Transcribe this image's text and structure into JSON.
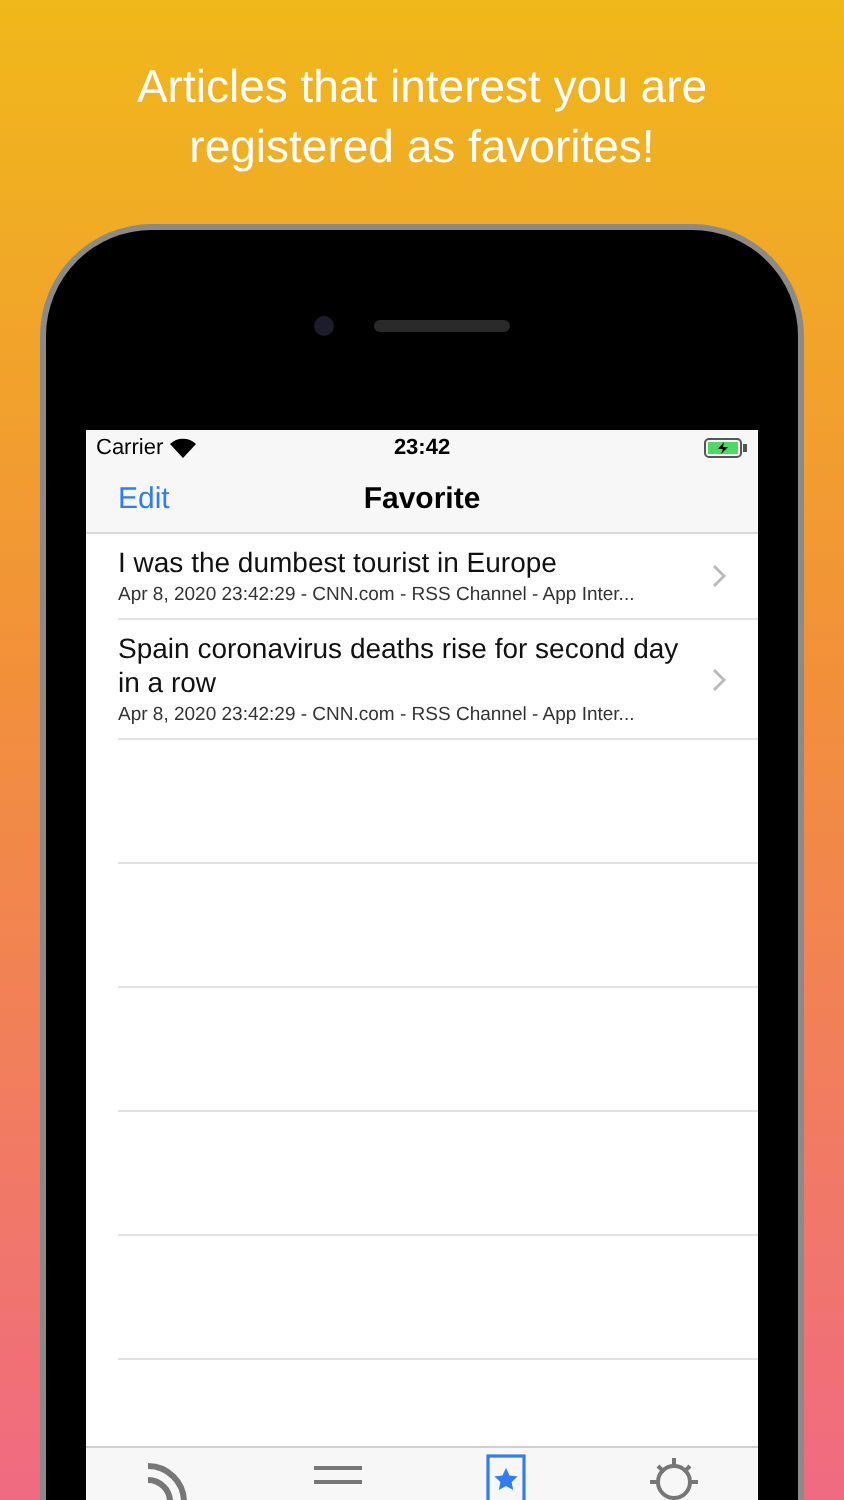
{
  "headline": "Articles that interest you are registered as favorites!",
  "status_bar": {
    "carrier": "Carrier",
    "time": "23:42"
  },
  "nav_bar": {
    "left_button": "Edit",
    "title": "Favorite"
  },
  "articles": [
    {
      "title": "I was the dumbest tourist in Europe",
      "subtitle": "Apr 8, 2020 23:42:29 - CNN.com - RSS Channel - App Inter..."
    },
    {
      "title": "Spain coronavirus deaths rise for second day in a row",
      "subtitle": "Apr 8, 2020 23:42:29 - CNN.com - RSS Channel - App Inter..."
    }
  ],
  "tab_bar": [
    {
      "kind": "feed",
      "selected": false
    },
    {
      "kind": "list",
      "selected": false
    },
    {
      "kind": "favorite",
      "selected": true
    },
    {
      "kind": "settings",
      "selected": false
    }
  ]
}
